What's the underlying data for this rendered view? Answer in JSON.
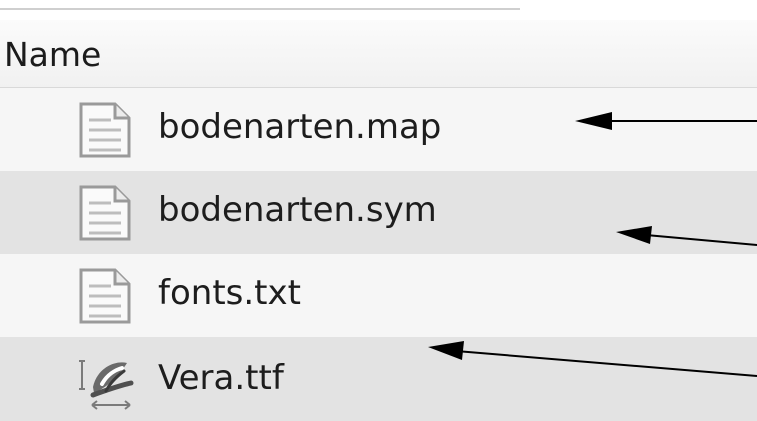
{
  "columns": {
    "name_label": "Name"
  },
  "files": [
    {
      "name": "bodenarten.map",
      "icon": "document-icon"
    },
    {
      "name": "bodenarten.sym",
      "icon": "document-icon"
    },
    {
      "name": "fonts.txt",
      "icon": "document-icon"
    },
    {
      "name": "Vera.ttf",
      "icon": "truetype-font-icon"
    }
  ],
  "colors": {
    "row_light": "#f6f6f6",
    "row_dark": "#e3e3e3",
    "arrow": "#000000"
  }
}
